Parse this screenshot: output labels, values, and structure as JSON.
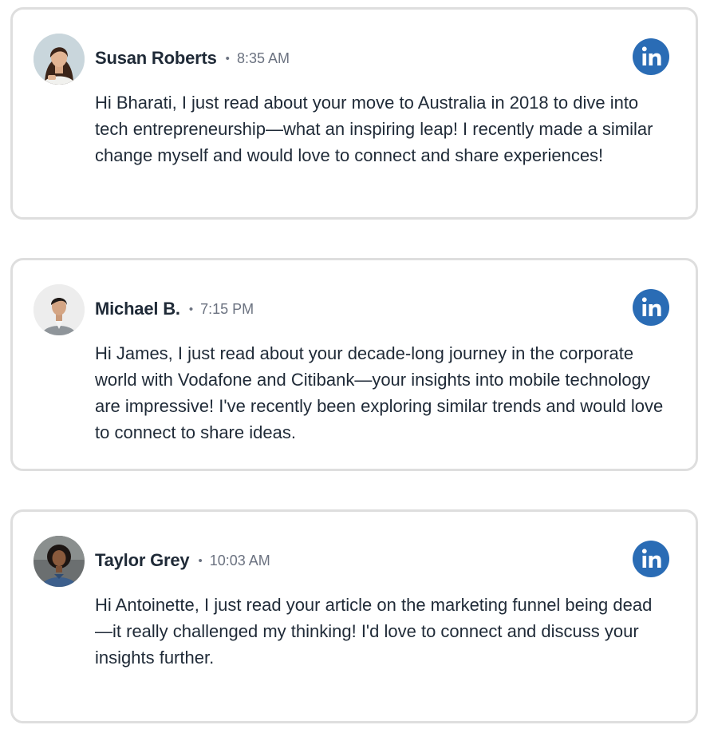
{
  "messages": [
    {
      "name": "Susan Roberts",
      "separator": "•",
      "time": "8:35 AM",
      "text": "Hi Bharati, I just read about your move to Australia in 2018 to dive into tech entrepreneurship—what an inspiring leap! I recently made a similar change myself and would love to connect and share experiences!",
      "avatar_icon": "avatar-woman-long-dark-hair",
      "platform_icon": "linkedin-icon"
    },
    {
      "name": "Michael B.",
      "separator": "•",
      "time": "7:15 PM",
      "text": "Hi James, I just read about your decade-long journey in the corporate world with Vodafone and Citibank—your insights into mobile technology are impressive! I've recently been exploring similar trends and would love to connect to share ideas.",
      "avatar_icon": "avatar-man-grey-blazer",
      "platform_icon": "linkedin-icon"
    },
    {
      "name": "Taylor Grey",
      "separator": "•",
      "time": "10:03 AM",
      "text": "Hi Antoinette, I just read your article on the marketing funnel being dead—it really challenged my thinking! I'd love to connect and discuss your insights further.",
      "avatar_icon": "avatar-woman-curly-hair",
      "platform_icon": "linkedin-icon"
    }
  ],
  "colors": {
    "linkedin_blue": "#2a6cb5",
    "name_text": "#1f2a37",
    "meta_text": "#6b7280",
    "card_border": "#dedede"
  }
}
